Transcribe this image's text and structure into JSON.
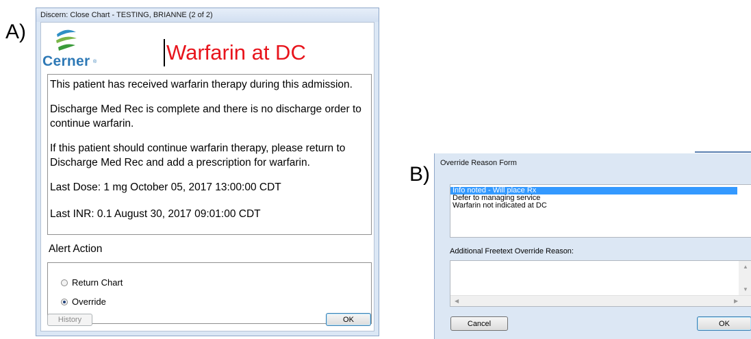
{
  "labels": {
    "a": "A)",
    "b": "B)"
  },
  "window_a": {
    "title": "Discern: Close Chart - TESTING, BRIANNE (2 of 2)",
    "logo_text": "Cerner",
    "logo_tm": "®",
    "alert_title": "Warfarin at DC",
    "message": {
      "p1": "This patient has received warfarin therapy during this admission.",
      "p2": " Discharge Med Rec is complete and there is no discharge order to continue warfarin.",
      "p3": " If this patient should continue warfarin therapy, please return to Discharge Med Rec and add a prescription for warfarin.",
      "p4": " Last Dose: 1 mg  October 05, 2017 13:00:00 CDT",
      "p5": " Last INR: 0.1  August 30, 2017 09:01:00 CDT"
    },
    "alert_action_label": "Alert Action",
    "options": {
      "return_chart": "Return Chart",
      "override": "Override"
    },
    "selected_option": "override",
    "buttons": {
      "history": "History",
      "ok": "OK"
    },
    "colors": {
      "alert_title": "#e8141c",
      "logo": "#2e79b6"
    }
  },
  "window_b": {
    "title": "Override Reason Form",
    "reasons": [
      "Info noted - Will place Rx",
      "Defer to managing service",
      "Warfarin not indicated at DC"
    ],
    "selected_reason": "Info noted - Will place Rx",
    "freetext_label": "Additional Freetext Override Reason:",
    "freetext_value": "",
    "buttons": {
      "cancel": "Cancel",
      "ok": "OK"
    },
    "colors": {
      "selection": "#3399ff"
    }
  }
}
